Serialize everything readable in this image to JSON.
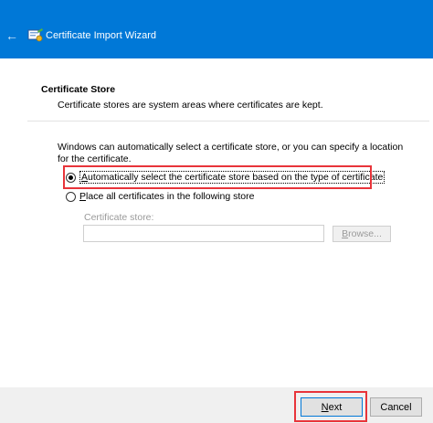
{
  "window": {
    "title": "Certificate Import Wizard",
    "back_icon": "left-arrow-icon",
    "app_icon": "certificate-wizard-icon",
    "accent_color": "#0078d7"
  },
  "header": {
    "section_title": "Certificate Store",
    "section_desc": "Certificate stores are system areas where certificates are kept."
  },
  "body": {
    "intro": "Windows can automatically select a certificate store, or you can specify a location for the certificate.",
    "option_auto": "Automatically select the certificate store based on the type of certificate",
    "option_manual": "Place all certificates in the following store",
    "option_auto_selected": true,
    "store_label": "Certificate store:",
    "store_value": "",
    "browse_label": "Browse...",
    "highlight_color": "#e8343a"
  },
  "footer": {
    "next_label": "Next",
    "cancel_label": "Cancel"
  }
}
